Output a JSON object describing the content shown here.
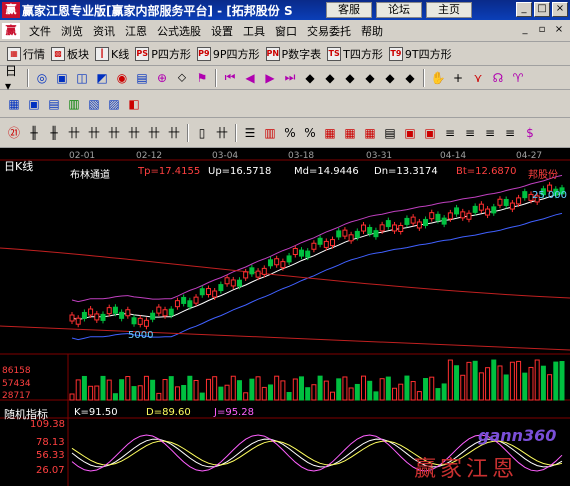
{
  "titlebar": {
    "title": "赢家江恩专业版[赢家内部服务平台] - [拓邦股份 S",
    "web_buttons": [
      "客服",
      "论坛",
      "主页"
    ]
  },
  "menubar": {
    "items": [
      "文件",
      "浏览",
      "资讯",
      "江恩",
      "公式选股",
      "设置",
      "工具",
      "窗口",
      "交易委托",
      "帮助"
    ]
  },
  "toolbar1": [
    "行情",
    "板块",
    "K线",
    "P四方形",
    "9P四方形",
    "P数字表",
    "T四方形",
    "9T四方形"
  ],
  "chart": {
    "period_label": "日K线",
    "dates": [
      "02-01",
      "02-12",
      "03-04",
      "03-18",
      "03-31",
      "04-14",
      "04-27"
    ],
    "indicator_name": "布林通道",
    "tp": "Tp=17.4155",
    "up": "Up=16.5718",
    "md": "Md=14.9446",
    "dn": "Dn=13.3174",
    "bt": "Bt=12.6870",
    "stock_tag": "邦股份",
    "high_label": "25.000",
    "low_label": "5000",
    "volume_ticks": [
      "86158",
      "57434",
      "28717"
    ],
    "stoch_name": "随机指标",
    "k": "K=91.50",
    "d": "D=89.60",
    "j": "J=95.28",
    "stoch_ticks": [
      "109.38",
      "78.13",
      "56.33",
      "26.07"
    ],
    "watermark": "赢家江恩",
    "watermark_logo": "gann360"
  },
  "chart_data": {
    "type": "candlestick",
    "x": [
      "02-01",
      "02-12",
      "03-04",
      "03-18",
      "03-31",
      "04-14",
      "04-27"
    ],
    "indicators": {
      "Tp": 17.4155,
      "Up": 16.5718,
      "Md": 14.9446,
      "Dn": 13.3174,
      "Bt": 12.687
    },
    "volume_ticks": [
      86158,
      57434,
      28717
    ],
    "stochastic": {
      "K": 91.5,
      "D": 89.6,
      "J": 95.28,
      "ticks": [
        109.38,
        78.13,
        56.33,
        26.07
      ]
    }
  },
  "colors": {
    "up": "#ff3030",
    "down": "#00c040",
    "bg": "#000000"
  }
}
